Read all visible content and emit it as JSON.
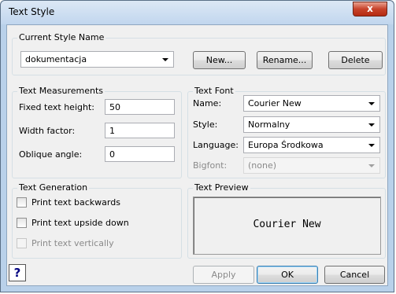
{
  "window": {
    "title": "Text Style",
    "close_glyph": "x"
  },
  "current_style": {
    "group_label": "Current Style Name",
    "selected": "dokumentacja",
    "new_label": "New...",
    "rename_label": "Rename...",
    "delete_label": "Delete"
  },
  "measurements": {
    "group_label": "Text Measurements",
    "fixed_height_label": "Fixed text height:",
    "fixed_height_value": "50",
    "width_factor_label": "Width factor:",
    "width_factor_value": "1",
    "oblique_label": "Oblique angle:",
    "oblique_value": "0"
  },
  "font": {
    "group_label": "Text Font",
    "name_label": "Name:",
    "name_value": "Courier New",
    "style_label": "Style:",
    "style_value": "Normalny",
    "language_label": "Language:",
    "language_value": "Europa Środkowa",
    "bigfont_label": "Bigfont:",
    "bigfont_value": "(none)"
  },
  "generation": {
    "group_label": "Text Generation",
    "backwards_label": "Print text backwards",
    "upside_down_label": "Print text upside down",
    "vertical_label": "Print text vertically"
  },
  "preview": {
    "group_label": "Text Preview",
    "sample_text": "Courier New"
  },
  "footer": {
    "help_glyph": "?",
    "apply_label": "Apply",
    "ok_label": "OK",
    "cancel_label": "Cancel"
  },
  "colors": {
    "frame": "#b9d1ea",
    "client": "#f0f0f0",
    "close": "#c7432b"
  }
}
